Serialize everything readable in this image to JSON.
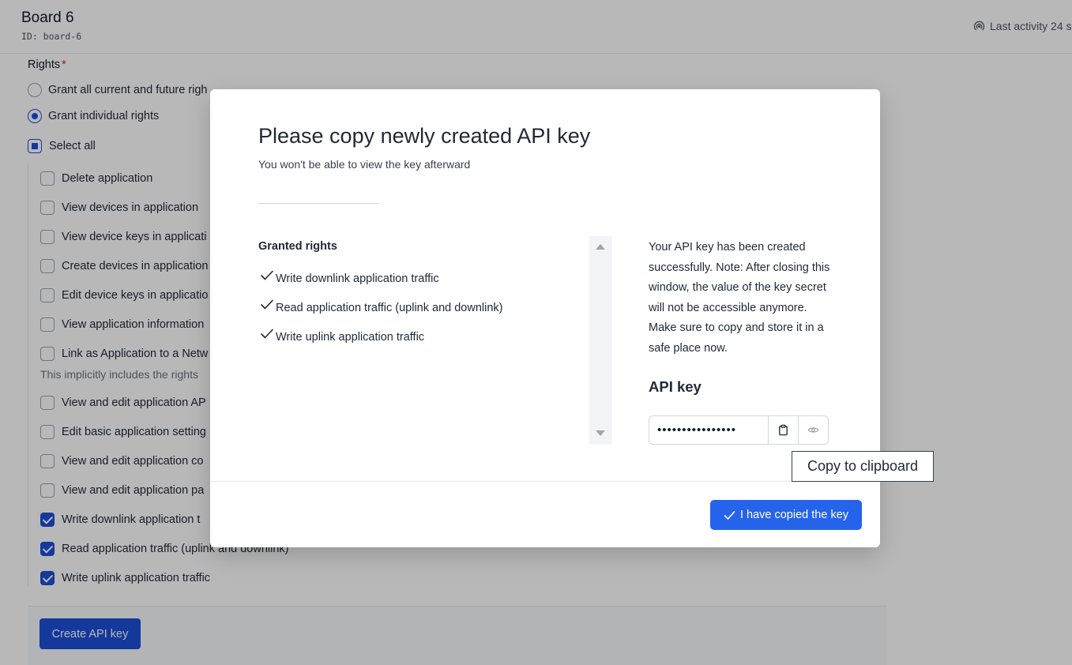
{
  "header": {
    "title": "Board 6",
    "id_label": "ID: board-6",
    "activity": "Last activity 24 s"
  },
  "form": {
    "rights_label": "Rights",
    "required_marker": "*",
    "radio_all": "Grant all current and future righ",
    "radio_individual": "Grant individual rights",
    "select_all": "Select all",
    "rights": [
      {
        "label": "Delete application",
        "checked": false
      },
      {
        "label": "View devices in application",
        "checked": false
      },
      {
        "label": "View device keys in applicati",
        "checked": false
      },
      {
        "label": "Create devices in application",
        "checked": false
      },
      {
        "label": "Edit device keys in applicatio",
        "checked": false
      },
      {
        "label": "View application information",
        "checked": false
      },
      {
        "label": "Link as Application to a Netw",
        "checked": false
      },
      {
        "label": "View and edit application AP",
        "checked": false
      },
      {
        "label": "Edit basic application setting",
        "checked": false
      },
      {
        "label": "View and edit application co",
        "checked": false
      },
      {
        "label": "View and edit application pa",
        "checked": false
      },
      {
        "label": "Write downlink application t",
        "checked": true
      },
      {
        "label": "Read application traffic (uplink and downlink)",
        "checked": true
      },
      {
        "label": "Write uplink application traffic",
        "checked": true
      }
    ],
    "link_hint": "This implicitly includes the rights",
    "create_button": "Create API key"
  },
  "modal": {
    "title": "Please copy newly created API key",
    "subtitle": "You won't be able to view the key afterward",
    "granted_heading": "Granted rights",
    "granted": [
      "Write downlink application traffic",
      "Read application traffic (uplink and downlink)",
      "Write uplink application traffic"
    ],
    "info": "Your API key has been created successfully. Note: After closing this window, the value of the key secret will not be accessible anymore. Make sure to copy and store it in a safe place now.",
    "api_key_heading": "API key",
    "api_key_masked": "••••••••••••••••",
    "confirm_button": "I have copied the key",
    "tooltip": "Copy to clipboard"
  },
  "icons": {
    "activity": "signal-icon",
    "copy": "clipboard-icon",
    "reveal": "eye-icon",
    "check": "check-icon"
  },
  "colors": {
    "primary": "#2563eb",
    "primary_dark": "#1d4ed8",
    "required": "#dc2626"
  }
}
